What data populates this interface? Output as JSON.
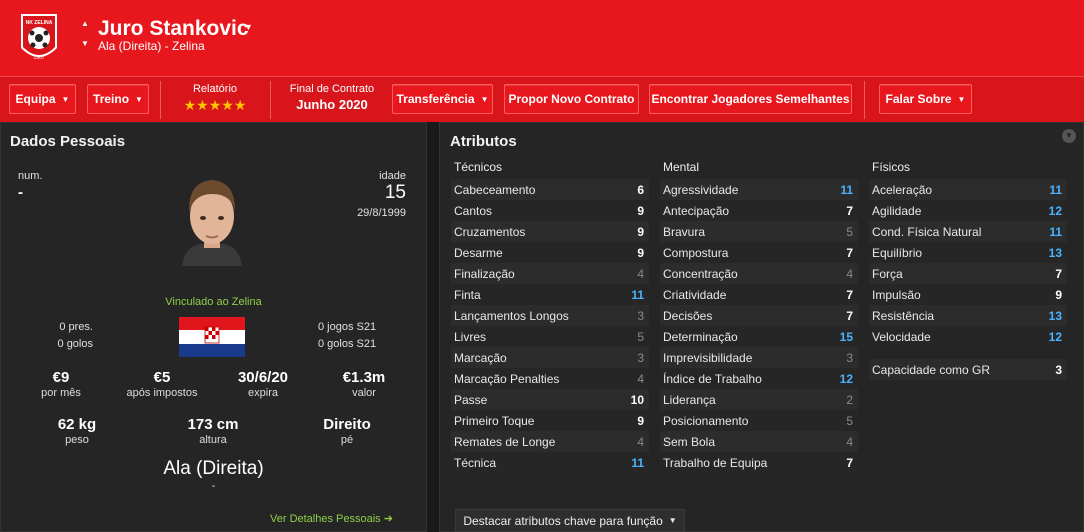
{
  "player": {
    "name": "Juro Stankovic",
    "position_club": "Ala (Direita) - Zelina"
  },
  "club": {
    "crest_text": "NK ZELINA",
    "crest_year": "1907"
  },
  "toolbar": {
    "squad": "Equipa",
    "training": "Treino",
    "report_label": "Relatório",
    "report_stars": "★★★★★",
    "contract_label": "Final de Contrato",
    "contract_value": "Junho 2020",
    "transfer": "Transferência",
    "offer_contract": "Propor Novo Contrato",
    "find_similar": "Encontrar Jogadores Semelhantes",
    "talk": "Falar Sobre"
  },
  "personal": {
    "title": "Dados Pessoais",
    "num_label": "num.",
    "num_value": "-",
    "age_label": "idade",
    "age_value": "15",
    "dob": "29/8/1999",
    "linked": "Vinculado ao Zelina",
    "apps": "0 pres.",
    "goals": "0 golos",
    "u21_apps": "0 jogos S21",
    "u21_goals": "0 golos S21",
    "wage": "€9",
    "wage_label": "por mês",
    "net": "€5",
    "net_label": "após impostos",
    "expires": "30/6/20",
    "expires_label": "expira",
    "value": "€1.3m",
    "value_label": "valor",
    "weight": "62 kg",
    "weight_label": "peso",
    "height": "173 cm",
    "height_label": "altura",
    "foot": "Direito",
    "foot_label": "pé",
    "position": "Ala (Direita)",
    "position_sub": "-",
    "details_link": "Ver Detalhes Pessoais"
  },
  "attributes": {
    "title": "Atributos",
    "technical_title": "Técnicos",
    "mental_title": "Mental",
    "physical_title": "Físicos",
    "technical": [
      {
        "name": "Cabeceamento",
        "value": "6"
      },
      {
        "name": "Cantos",
        "value": "9"
      },
      {
        "name": "Cruzamentos",
        "value": "9"
      },
      {
        "name": "Desarme",
        "value": "9"
      },
      {
        "name": "Finalização",
        "value": "4"
      },
      {
        "name": "Finta",
        "value": "11"
      },
      {
        "name": "Lançamentos Longos",
        "value": "3"
      },
      {
        "name": "Livres",
        "value": "5"
      },
      {
        "name": "Marcação",
        "value": "3"
      },
      {
        "name": "Marcação Penalties",
        "value": "4"
      },
      {
        "name": "Passe",
        "value": "10"
      },
      {
        "name": "Primeiro Toque",
        "value": "9"
      },
      {
        "name": "Remates de Longe",
        "value": "4"
      },
      {
        "name": "Técnica",
        "value": "11"
      }
    ],
    "mental": [
      {
        "name": "Agressividade",
        "value": "11"
      },
      {
        "name": "Antecipação",
        "value": "7"
      },
      {
        "name": "Bravura",
        "value": "5"
      },
      {
        "name": "Compostura",
        "value": "7"
      },
      {
        "name": "Concentração",
        "value": "4"
      },
      {
        "name": "Criatividade",
        "value": "7"
      },
      {
        "name": "Decisões",
        "value": "7"
      },
      {
        "name": "Determinação",
        "value": "15"
      },
      {
        "name": "Imprevisibilidade",
        "value": "3"
      },
      {
        "name": "Índice de Trabalho",
        "value": "12"
      },
      {
        "name": "Liderança",
        "value": "2"
      },
      {
        "name": "Posicionamento",
        "value": "5"
      },
      {
        "name": "Sem Bola",
        "value": "4"
      },
      {
        "name": "Trabalho de Equipa",
        "value": "7"
      }
    ],
    "physical": [
      {
        "name": "Aceleração",
        "value": "11"
      },
      {
        "name": "Agilidade",
        "value": "12"
      },
      {
        "name": "Cond. Física Natural",
        "value": "11"
      },
      {
        "name": "Equilíbrio",
        "value": "13"
      },
      {
        "name": "Força",
        "value": "7"
      },
      {
        "name": "Impulsão",
        "value": "9"
      },
      {
        "name": "Resistência",
        "value": "13"
      },
      {
        "name": "Velocidade",
        "value": "12"
      }
    ],
    "gk_label": "Capacidade como GR",
    "gk_value": "3",
    "highlight_button": "Destacar atributos chave para função"
  },
  "colors": {
    "header": "#e8171d",
    "stars": "#ffc400",
    "high_attr": "#4ab3ff",
    "link": "#8fcf4a"
  }
}
